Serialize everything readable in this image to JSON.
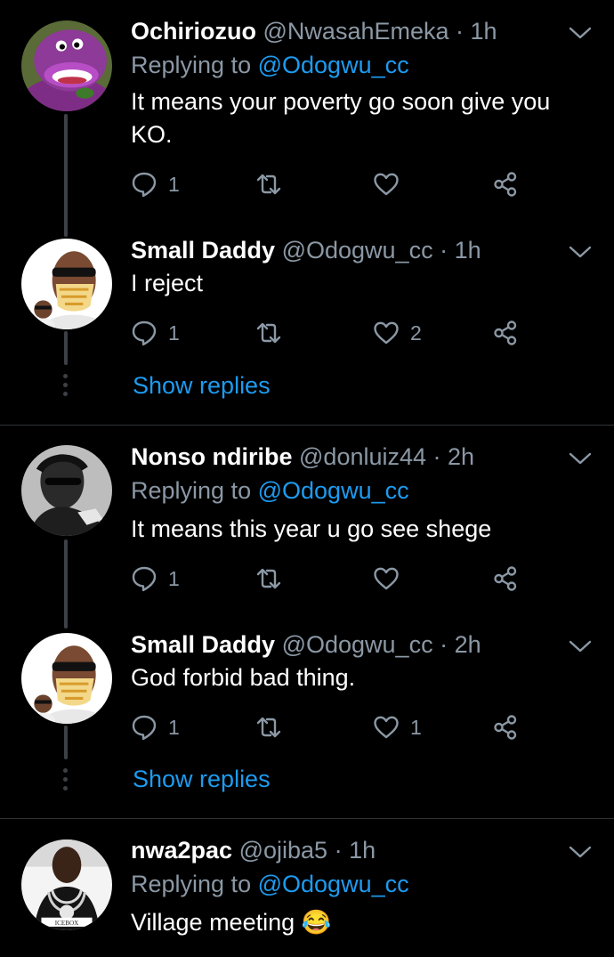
{
  "replies": [
    {
      "name": "Ochiriozuo",
      "handle": "@NwasahEmeka",
      "time": "· 1h",
      "replying_prefix": "Replying to",
      "replying_handle": "@Odogwu_cc",
      "text": "It means your poverty go soon give you KO.",
      "reply_count": "1",
      "retweet_count": "",
      "like_count": ""
    },
    {
      "name": "Small Daddy",
      "handle": "@Odogwu_cc",
      "time": "· 1h",
      "text": "I reject",
      "reply_count": "1",
      "retweet_count": "",
      "like_count": "2",
      "show_replies": "Show replies"
    },
    {
      "name": "Nonso ndiribe",
      "handle": "@donluiz44",
      "time": "· 2h",
      "replying_prefix": "Replying to",
      "replying_handle": "@Odogwu_cc",
      "text": "It means this year u go see shege",
      "reply_count": "1",
      "retweet_count": "",
      "like_count": ""
    },
    {
      "name": "Small Daddy",
      "handle": "@Odogwu_cc",
      "time": "· 2h",
      "text": "God forbid bad thing.",
      "reply_count": "1",
      "retweet_count": "",
      "like_count": "1",
      "show_replies": "Show replies"
    },
    {
      "name": "nwa2pac",
      "handle": "@ojiba5",
      "time": "· 1h",
      "replying_prefix": "Replying to",
      "replying_handle": "@Odogwu_cc",
      "text": "Village meeting 😂",
      "avatar_caption": "ICEBOX"
    }
  ],
  "icons": {
    "reply": "reply-icon",
    "retweet": "retweet-icon",
    "like": "heart-icon",
    "share": "share-icon",
    "more": "chevron-down-icon"
  },
  "colors": {
    "background": "#000000",
    "text": "#ffffff",
    "muted": "#8b98a5",
    "link": "#1d9bf0",
    "thread_line": "#3d4145"
  }
}
